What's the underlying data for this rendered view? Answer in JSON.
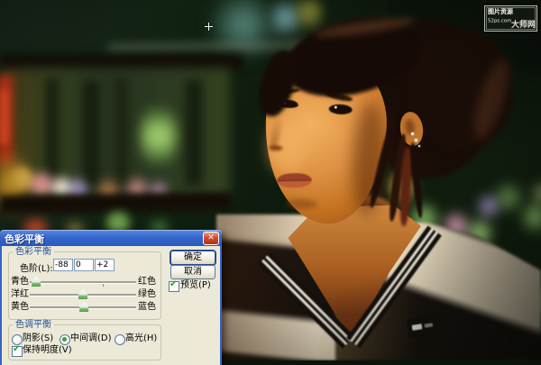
{
  "window": {
    "title": "色彩平衡"
  },
  "color_balance": {
    "legend": "色彩平衡",
    "levels_label": "色阶(L):",
    "levels": [
      "-88",
      "0",
      "+2"
    ],
    "sliders": [
      {
        "left": "青色",
        "right": "红色",
        "value": -88
      },
      {
        "left": "洋红",
        "right": "绿色",
        "value": 0
      },
      {
        "left": "黄色",
        "right": "蓝色",
        "value": 2
      }
    ]
  },
  "tone_balance": {
    "legend": "色调平衡",
    "radios": [
      {
        "label": "阴影(S)",
        "checked": false
      },
      {
        "label": "中间调(D)",
        "checked": true
      },
      {
        "label": "高光(H)",
        "checked": false
      }
    ],
    "preserve": {
      "label": "保持明度(V)",
      "checked": true
    }
  },
  "buttons": {
    "ok": "确定",
    "cancel": "取消"
  },
  "preview": {
    "label": "预览(P)",
    "checked": true
  },
  "watermark": {
    "line1": "图片资源",
    "line2": "52ps.com",
    "badge": "大师网"
  },
  "icons": {
    "close": "✕",
    "check": "✔"
  },
  "colors": {
    "titlebar_blue": "#3668cc",
    "dialog_bg": "#ece9d8",
    "close_button_red": "#d0452c",
    "check_green": "#21a528",
    "radio_green": "#35a435",
    "group_label_blue": "#23509b",
    "slider_thumb_green": "#4e9e44"
  }
}
